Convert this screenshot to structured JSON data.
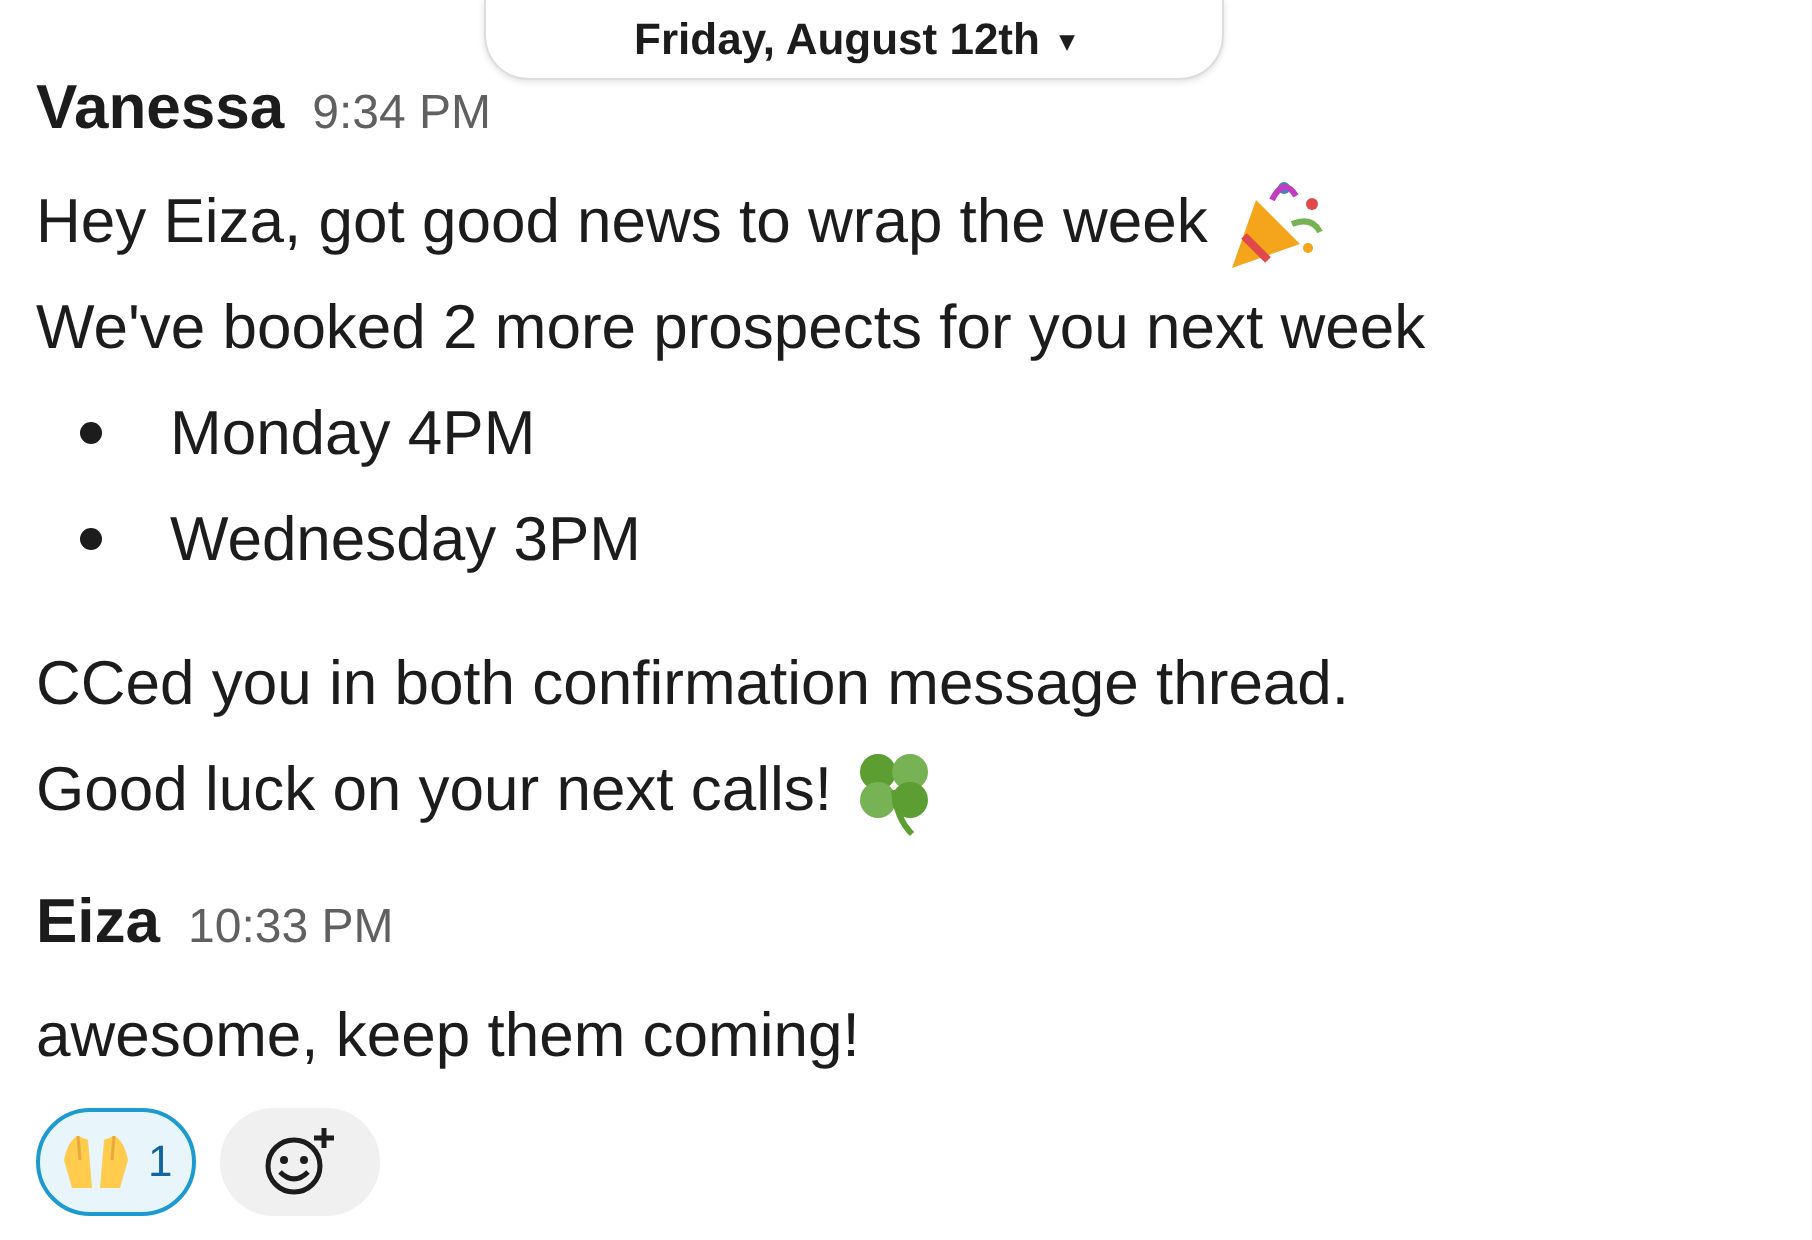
{
  "date_divider": {
    "label": "Friday, August 12th",
    "caret": "▾"
  },
  "messages": [
    {
      "author": "Vanessa",
      "time": "9:34 PM",
      "blocks": [
        {
          "kind": "line",
          "text": "Hey Eiza, got good news to wrap the week",
          "trailing_icon": {
            "kind": "party-popper"
          }
        },
        {
          "kind": "line",
          "text": "We've booked 2 more prospects for you next week"
        },
        {
          "kind": "bullets",
          "items": [
            "Monday 4PM",
            "Wednesday 3PM"
          ]
        },
        {
          "kind": "gap"
        },
        {
          "kind": "line",
          "text": "CCed you in both confirmation message thread."
        },
        {
          "kind": "line",
          "text": "Good luck on your next calls!",
          "trailing_icon": {
            "kind": "clover"
          }
        }
      ]
    },
    {
      "author": "Eiza",
      "time": "10:33 PM",
      "blocks": [
        {
          "kind": "line",
          "text": "awesome, keep them coming!"
        }
      ],
      "reactions": [
        {
          "icon": {
            "kind": "raised-hands"
          },
          "count": "1",
          "selected": true
        }
      ],
      "add_reaction": true
    }
  ]
}
